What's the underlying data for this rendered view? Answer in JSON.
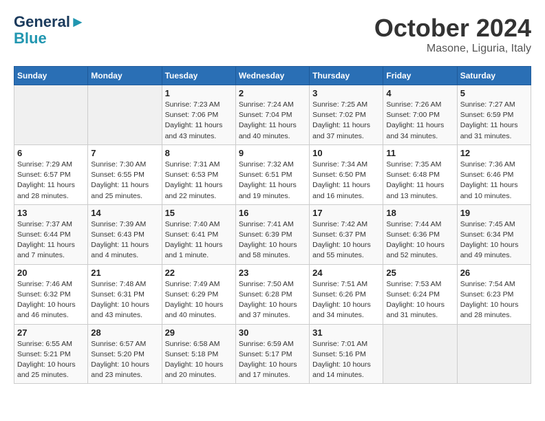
{
  "header": {
    "logo_line1": "General",
    "logo_line2": "Blue",
    "month_year": "October 2024",
    "location": "Masone, Liguria, Italy"
  },
  "weekdays": [
    "Sunday",
    "Monday",
    "Tuesday",
    "Wednesday",
    "Thursday",
    "Friday",
    "Saturday"
  ],
  "weeks": [
    [
      {
        "day": "",
        "sunrise": "",
        "sunset": "",
        "daylight": ""
      },
      {
        "day": "",
        "sunrise": "",
        "sunset": "",
        "daylight": ""
      },
      {
        "day": "1",
        "sunrise": "Sunrise: 7:23 AM",
        "sunset": "Sunset: 7:06 PM",
        "daylight": "Daylight: 11 hours and 43 minutes."
      },
      {
        "day": "2",
        "sunrise": "Sunrise: 7:24 AM",
        "sunset": "Sunset: 7:04 PM",
        "daylight": "Daylight: 11 hours and 40 minutes."
      },
      {
        "day": "3",
        "sunrise": "Sunrise: 7:25 AM",
        "sunset": "Sunset: 7:02 PM",
        "daylight": "Daylight: 11 hours and 37 minutes."
      },
      {
        "day": "4",
        "sunrise": "Sunrise: 7:26 AM",
        "sunset": "Sunset: 7:00 PM",
        "daylight": "Daylight: 11 hours and 34 minutes."
      },
      {
        "day": "5",
        "sunrise": "Sunrise: 7:27 AM",
        "sunset": "Sunset: 6:59 PM",
        "daylight": "Daylight: 11 hours and 31 minutes."
      }
    ],
    [
      {
        "day": "6",
        "sunrise": "Sunrise: 7:29 AM",
        "sunset": "Sunset: 6:57 PM",
        "daylight": "Daylight: 11 hours and 28 minutes."
      },
      {
        "day": "7",
        "sunrise": "Sunrise: 7:30 AM",
        "sunset": "Sunset: 6:55 PM",
        "daylight": "Daylight: 11 hours and 25 minutes."
      },
      {
        "day": "8",
        "sunrise": "Sunrise: 7:31 AM",
        "sunset": "Sunset: 6:53 PM",
        "daylight": "Daylight: 11 hours and 22 minutes."
      },
      {
        "day": "9",
        "sunrise": "Sunrise: 7:32 AM",
        "sunset": "Sunset: 6:51 PM",
        "daylight": "Daylight: 11 hours and 19 minutes."
      },
      {
        "day": "10",
        "sunrise": "Sunrise: 7:34 AM",
        "sunset": "Sunset: 6:50 PM",
        "daylight": "Daylight: 11 hours and 16 minutes."
      },
      {
        "day": "11",
        "sunrise": "Sunrise: 7:35 AM",
        "sunset": "Sunset: 6:48 PM",
        "daylight": "Daylight: 11 hours and 13 minutes."
      },
      {
        "day": "12",
        "sunrise": "Sunrise: 7:36 AM",
        "sunset": "Sunset: 6:46 PM",
        "daylight": "Daylight: 11 hours and 10 minutes."
      }
    ],
    [
      {
        "day": "13",
        "sunrise": "Sunrise: 7:37 AM",
        "sunset": "Sunset: 6:44 PM",
        "daylight": "Daylight: 11 hours and 7 minutes."
      },
      {
        "day": "14",
        "sunrise": "Sunrise: 7:39 AM",
        "sunset": "Sunset: 6:43 PM",
        "daylight": "Daylight: 11 hours and 4 minutes."
      },
      {
        "day": "15",
        "sunrise": "Sunrise: 7:40 AM",
        "sunset": "Sunset: 6:41 PM",
        "daylight": "Daylight: 11 hours and 1 minute."
      },
      {
        "day": "16",
        "sunrise": "Sunrise: 7:41 AM",
        "sunset": "Sunset: 6:39 PM",
        "daylight": "Daylight: 10 hours and 58 minutes."
      },
      {
        "day": "17",
        "sunrise": "Sunrise: 7:42 AM",
        "sunset": "Sunset: 6:37 PM",
        "daylight": "Daylight: 10 hours and 55 minutes."
      },
      {
        "day": "18",
        "sunrise": "Sunrise: 7:44 AM",
        "sunset": "Sunset: 6:36 PM",
        "daylight": "Daylight: 10 hours and 52 minutes."
      },
      {
        "day": "19",
        "sunrise": "Sunrise: 7:45 AM",
        "sunset": "Sunset: 6:34 PM",
        "daylight": "Daylight: 10 hours and 49 minutes."
      }
    ],
    [
      {
        "day": "20",
        "sunrise": "Sunrise: 7:46 AM",
        "sunset": "Sunset: 6:32 PM",
        "daylight": "Daylight: 10 hours and 46 minutes."
      },
      {
        "day": "21",
        "sunrise": "Sunrise: 7:48 AM",
        "sunset": "Sunset: 6:31 PM",
        "daylight": "Daylight: 10 hours and 43 minutes."
      },
      {
        "day": "22",
        "sunrise": "Sunrise: 7:49 AM",
        "sunset": "Sunset: 6:29 PM",
        "daylight": "Daylight: 10 hours and 40 minutes."
      },
      {
        "day": "23",
        "sunrise": "Sunrise: 7:50 AM",
        "sunset": "Sunset: 6:28 PM",
        "daylight": "Daylight: 10 hours and 37 minutes."
      },
      {
        "day": "24",
        "sunrise": "Sunrise: 7:51 AM",
        "sunset": "Sunset: 6:26 PM",
        "daylight": "Daylight: 10 hours and 34 minutes."
      },
      {
        "day": "25",
        "sunrise": "Sunrise: 7:53 AM",
        "sunset": "Sunset: 6:24 PM",
        "daylight": "Daylight: 10 hours and 31 minutes."
      },
      {
        "day": "26",
        "sunrise": "Sunrise: 7:54 AM",
        "sunset": "Sunset: 6:23 PM",
        "daylight": "Daylight: 10 hours and 28 minutes."
      }
    ],
    [
      {
        "day": "27",
        "sunrise": "Sunrise: 6:55 AM",
        "sunset": "Sunset: 5:21 PM",
        "daylight": "Daylight: 10 hours and 25 minutes."
      },
      {
        "day": "28",
        "sunrise": "Sunrise: 6:57 AM",
        "sunset": "Sunset: 5:20 PM",
        "daylight": "Daylight: 10 hours and 23 minutes."
      },
      {
        "day": "29",
        "sunrise": "Sunrise: 6:58 AM",
        "sunset": "Sunset: 5:18 PM",
        "daylight": "Daylight: 10 hours and 20 minutes."
      },
      {
        "day": "30",
        "sunrise": "Sunrise: 6:59 AM",
        "sunset": "Sunset: 5:17 PM",
        "daylight": "Daylight: 10 hours and 17 minutes."
      },
      {
        "day": "31",
        "sunrise": "Sunrise: 7:01 AM",
        "sunset": "Sunset: 5:16 PM",
        "daylight": "Daylight: 10 hours and 14 minutes."
      },
      {
        "day": "",
        "sunrise": "",
        "sunset": "",
        "daylight": ""
      },
      {
        "day": "",
        "sunrise": "",
        "sunset": "",
        "daylight": ""
      }
    ]
  ]
}
